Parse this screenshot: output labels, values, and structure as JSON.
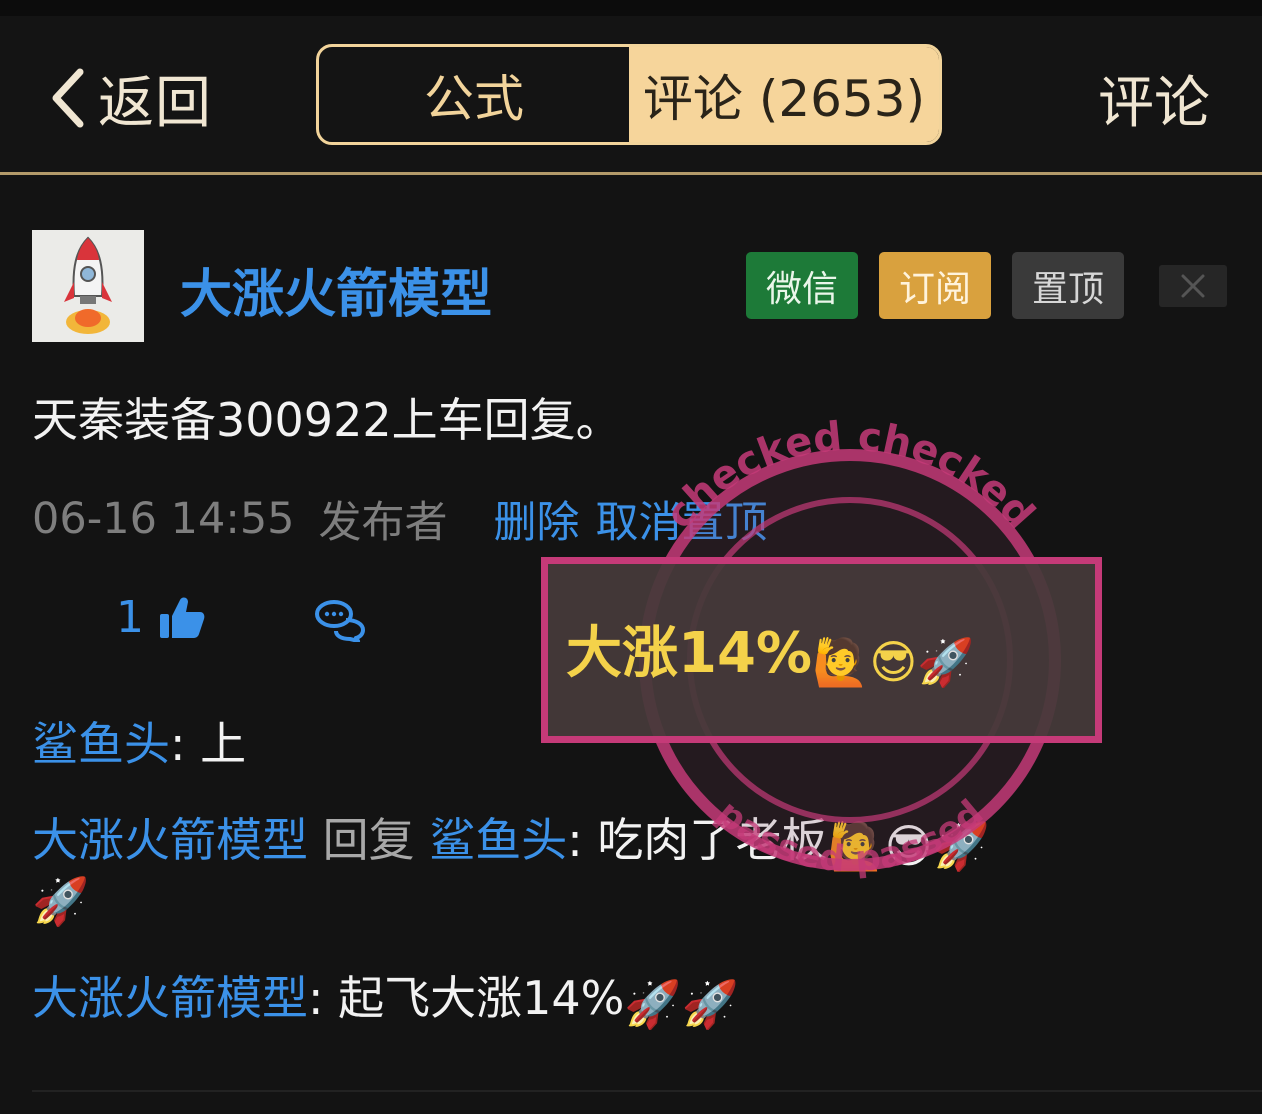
{
  "header": {
    "back_label": "返回",
    "tabs": [
      {
        "label": "公式",
        "active": false
      },
      {
        "label": "评论 (2653)",
        "active": true
      }
    ],
    "right_label": "评论"
  },
  "post": {
    "author": "大涨火箭模型",
    "tags": {
      "wechat": "微信",
      "subscribe": "订阅",
      "pin": "置顶"
    },
    "text": "天秦装备300922上车回复。",
    "timestamp": "06-16 14:55",
    "publisher_label": "发布者",
    "actions": {
      "delete": "删除",
      "unpin": "取消置顶"
    },
    "likes": "1"
  },
  "replies": [
    {
      "user": "鲨鱼头",
      "colon": ": ",
      "text": "上"
    },
    {
      "user": "大涨火箭模型",
      "reply_word": " 回复 ",
      "to": "鲨鱼头",
      "colon": ": ",
      "text": "吃肉了老板"
    },
    {
      "user": "大涨火箭模型",
      "colon": ": ",
      "text": "起飞大涨14%"
    }
  ],
  "emoji": {
    "raise_hand": "🙋",
    "cool": "😎",
    "rocket": "🚀"
  },
  "stamp": {
    "box_text": "大涨14%",
    "ring_top": "checked   checked",
    "ring_bottom": "passed   passed"
  },
  "colors": {
    "background": "#131313",
    "link_blue": "#3b91e8",
    "gold": "#f6d59b",
    "wechat_green": "#1d7a38",
    "subscribe_orange": "#d9a13e",
    "stamp_pink": "#c53a78",
    "stamp_yellow": "#f4d24a"
  },
  "icons": [
    "back-chevron-icon",
    "close-icon",
    "thumbs-up-icon",
    "comment-icon"
  ]
}
